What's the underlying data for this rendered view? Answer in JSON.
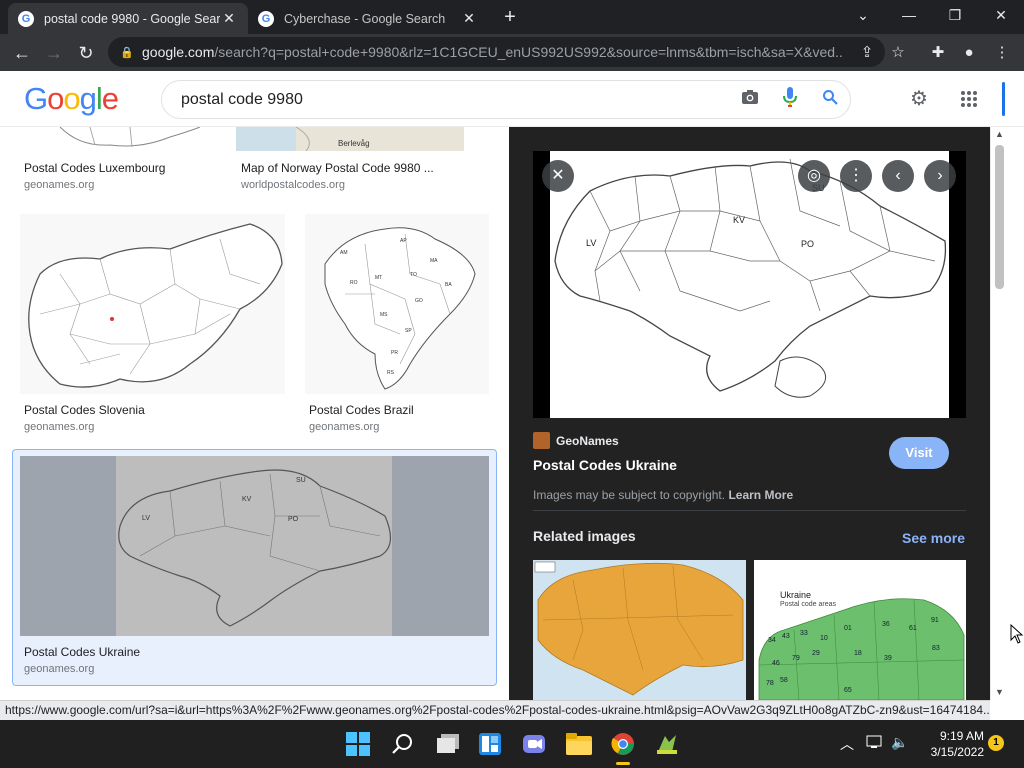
{
  "browser": {
    "tabs": [
      {
        "title": "postal code 9980 - Google Search",
        "active": true
      },
      {
        "title": "Cyberchase - Google Search",
        "active": false
      }
    ],
    "url_domain": "google.com",
    "url_rest": "/search?q=postal+code+9980&rlz=1C1GCEU_enUS992US992&source=lnms&tbm=isch&sa=X&ved...",
    "window_controls": {
      "minimize": "—",
      "restore": "❐",
      "close": "✕",
      "tabsearch": "⌄"
    }
  },
  "search": {
    "query": "postal code 9980"
  },
  "results": [
    {
      "caption": "Postal Codes Luxembourg",
      "source": "geonames.org"
    },
    {
      "caption": "Map of Norway Postal Code 9980 ...",
      "source": "worldpostalcodes.org",
      "map_label": "Berlevåg"
    },
    {
      "caption": "Postal Codes Slovenia",
      "source": "geonames.org"
    },
    {
      "caption": "Postal Codes Brazil",
      "source": "geonames.org"
    },
    {
      "caption": "Postal Codes Ukraine",
      "source": "geonames.org"
    }
  ],
  "map_labels": {
    "lv": "LV",
    "kv": "KV",
    "po": "PO",
    "su": "SU"
  },
  "preview": {
    "site_name": "GeoNames",
    "title": "Postal Codes Ukraine",
    "visit_label": "Visit",
    "copyright_text": "Images may be subject to copyright.",
    "learn_more": "Learn More",
    "related_heading": "Related images",
    "see_more": "See more",
    "related_2_title": "Ukraine",
    "related_2_subtitle": "Postal code areas"
  },
  "status_url": "https://www.google.com/url?sa=i&url=https%3A%2F%2Fwww.geonames.org%2Fpostal-codes%2Fpostal-codes-ukraine.html&psig=AOvVaw2G3q9ZLtH0o8gATZbC-zn9&ust=16474184...",
  "taskbar": {
    "time": "9:19 AM",
    "date": "3/15/2022",
    "notification_count": "1"
  },
  "colors": {
    "google_blue": "#4285f4",
    "google_red": "#ea4335",
    "google_yellow": "#fbbc05",
    "google_green": "#34a853",
    "visit_button": "#8ab4f8",
    "ukraine_map_green": "#6cbf6c",
    "ukraine_map_yellow": "#e8a53b"
  }
}
